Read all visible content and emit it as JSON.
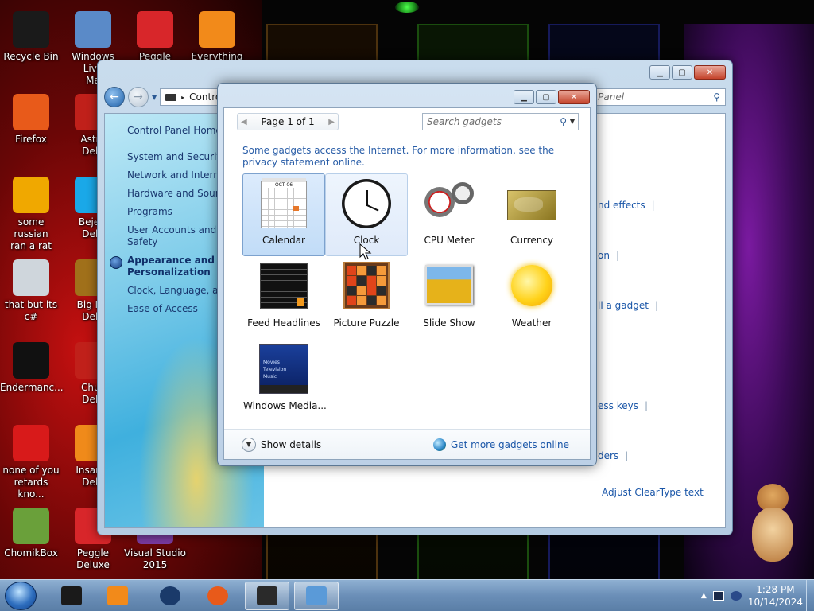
{
  "desktop": {
    "icons": [
      {
        "label": "Recycle Bin",
        "icon": "recycle-bin-icon",
        "color": "#1a1a1a"
      },
      {
        "label": "Windows Live\nMa",
        "icon": "mail-icon",
        "color": "#5a8ac8"
      },
      {
        "label": "Peggle World",
        "icon": "peggle-icon",
        "color": "#d8262a"
      },
      {
        "label": "Everything",
        "icon": "magnifier-icon",
        "color": "#f28a1a"
      },
      {
        "label": "Firefox",
        "icon": "firefox-icon",
        "color": "#e85a1a"
      },
      {
        "label": "Astro\nDelu",
        "icon": "astro-icon",
        "color": "#c0201a"
      },
      {
        "label": "some russian\nran a rat",
        "icon": "de-icon",
        "color": "#f0a800"
      },
      {
        "label": "Bejew\nDelu",
        "icon": "gem-icon",
        "color": "#1aa8e8"
      },
      {
        "label": "that but its c#",
        "icon": "windows-stack-icon",
        "color": "#cfd6dc"
      },
      {
        "label": "Big Mo\nDelu",
        "icon": "moneybag-icon",
        "color": "#a0701a"
      },
      {
        "label": "Endermanc...",
        "icon": "terminal-icon",
        "color": "#111111"
      },
      {
        "label": "Chuz\nDelu",
        "icon": "chuzzle-icon",
        "color": "#c0201a"
      },
      {
        "label": "none of you\nretards kno...",
        "icon": "dino-icon",
        "color": "#d81a1a"
      },
      {
        "label": "Insaniq\nDelu",
        "icon": "insaniquarium-icon",
        "color": "#f08a1a"
      },
      {
        "label": "ChomikBox",
        "icon": "hamster-box-icon",
        "color": "#6aa03a"
      },
      {
        "label": "Peggle Deluxe",
        "icon": "peggle-deluxe-icon",
        "color": "#d8262a"
      },
      {
        "label": "Visual Studio\n2015",
        "icon": "visual-studio-icon",
        "color": "#7a3aa0"
      }
    ]
  },
  "control_panel": {
    "address": "Contro",
    "search_placeholder": "l Panel",
    "sidebar": [
      {
        "label": "Control Panel Home",
        "kind": "home"
      },
      {
        "label": "System and Security"
      },
      {
        "label": "Network and Internet"
      },
      {
        "label": "Hardware and Sound"
      },
      {
        "label": "Programs"
      },
      {
        "label": "User Accounts and Fa\nSafety"
      },
      {
        "label": "Appearance and\nPersonalization",
        "kind": "active"
      },
      {
        "label": "Clock, Language, and"
      },
      {
        "label": "Ease of Access"
      }
    ],
    "main_links": [
      {
        "label": "nd effects"
      },
      {
        "label": "on"
      },
      {
        "label": "ll a gadget"
      },
      {
        "label": "ess keys"
      },
      {
        "label": "ders"
      },
      {
        "label": "Adjust ClearType text"
      }
    ]
  },
  "gadget_gallery": {
    "pager": "Page 1 of 1",
    "search_placeholder": "Search gadgets",
    "note": "Some gadgets access the Internet.  For more information, see the privacy statement online.",
    "gadgets": [
      {
        "label": "Calendar",
        "icon": "calendar-icon",
        "state": "selected",
        "cal_month": "OCT 06"
      },
      {
        "label": "Clock",
        "icon": "clock-icon",
        "state": "hover"
      },
      {
        "label": "CPU Meter",
        "icon": "cpu-meter-icon"
      },
      {
        "label": "Currency",
        "icon": "currency-icon"
      },
      {
        "label": "Feed Headlines",
        "icon": "rss-feed-icon"
      },
      {
        "label": "Picture Puzzle",
        "icon": "picture-puzzle-icon"
      },
      {
        "label": "Slide Show",
        "icon": "slide-show-icon"
      },
      {
        "label": "Weather",
        "icon": "weather-sun-icon"
      },
      {
        "label": "Windows Media...",
        "icon": "media-center-icon",
        "wmc_lines": [
          "Movies",
          "Television",
          "Music"
        ]
      }
    ],
    "show_details": "Show details",
    "more_online": "Get more gadgets online"
  },
  "taskbar": {
    "time": "1:28 PM",
    "date": "10/14/2024",
    "buttons": [
      {
        "icon": "black-box-icon",
        "color": "#1a1a1a"
      },
      {
        "icon": "media-player-icon",
        "color": "#f28a1a"
      },
      {
        "icon": "globe-app-icon",
        "color": "#1a3a6a"
      },
      {
        "icon": "firefox-icon",
        "color": "#e85a1a"
      },
      {
        "icon": "gadgets-app-icon",
        "color": "#2a2a2a",
        "active": true
      },
      {
        "icon": "control-panel-icon",
        "color": "#5a9ad8",
        "active": true
      }
    ]
  },
  "colors": {
    "accent_link": "#1a56a8",
    "selection": "#c1dcf7"
  }
}
